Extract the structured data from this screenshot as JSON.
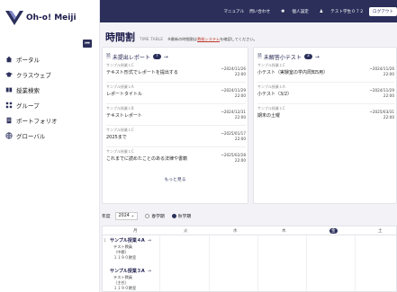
{
  "app": {
    "logo_text": "Oh-o! Meiji"
  },
  "sidebar": {
    "collapse_icon": "⏮",
    "items": [
      {
        "label": "ポータル",
        "icon": "home-icon"
      },
      {
        "label": "クラスウェブ",
        "icon": "graduation-cap-icon"
      },
      {
        "label": "授業検索",
        "icon": "book-icon"
      },
      {
        "label": "グループ",
        "icon": "group-icon"
      },
      {
        "label": "ポートフォリオ",
        "icon": "portfolio-icon"
      },
      {
        "label": "グローバル",
        "icon": "globe-icon"
      }
    ]
  },
  "header": {
    "links": {
      "manual": "マニュアル",
      "contact": "問い合わせ",
      "settings": "個人設定",
      "user": "テスト学生０７２",
      "logout": "ログアウト"
    }
  },
  "page": {
    "title": "時間割",
    "subtitle": "TIME TABLE",
    "note_prefix": "※最新の時間割は",
    "note_link": "教務システム",
    "note_suffix": "を確認してください。"
  },
  "reports": {
    "title": "未提出レポート",
    "count": "7",
    "more_label": "もっと見る",
    "items": [
      {
        "category": "サンプル授業１C",
        "title": "テキスト形式でレポートを提出する",
        "due_date": "~2024/11/26",
        "due_time": "22:00"
      },
      {
        "category": "サンプル授業１A",
        "title": "レポートタイトル",
        "due_date": "~2024/11/29",
        "due_time": "22:00"
      },
      {
        "category": "サンプル授業１B",
        "title": "テキストレポート",
        "due_date": "~2024/12/31",
        "due_time": "22:00"
      },
      {
        "category": "サンプル授業１C",
        "title": "2025まで",
        "due_date": "~2025/01/17",
        "due_time": "22:00"
      },
      {
        "category": "サンプル授業１C",
        "title": "これまでに読めたことのある法律や書籍",
        "due_date": "~2025/02/28",
        "due_time": "22:00"
      }
    ]
  },
  "quizzes": {
    "title": "未解答小テスト",
    "count": "3",
    "items": [
      {
        "category": "サンプル授業１C",
        "title": "小テスト（実験室の学内周知5用）",
        "due_date": "~2024/11/26",
        "due_time": "22:00"
      },
      {
        "category": "サンプル授業１A",
        "title": "小テスト（3/2）",
        "due_date": "~2024/11/29",
        "due_time": "22:00"
      },
      {
        "category": "サンプル授業１C",
        "title": "期末の土曜",
        "due_date": "~2025/03/31",
        "due_time": "22:00"
      }
    ]
  },
  "filters": {
    "year_label": "年度",
    "year_value": "2024",
    "term_spring": "春学期",
    "term_fall": "秋学期"
  },
  "timetable": {
    "days": [
      "月",
      "火",
      "水",
      "木",
      "金",
      "土"
    ],
    "period_label": "1",
    "courses": [
      {
        "name": "サンプル授業４A",
        "teacher": "テスト教員（中郡）",
        "room": "１１９０教室"
      },
      {
        "name": "サンプル授業３A",
        "teacher": "テスト教員（主任）",
        "room": "１１９０教室"
      }
    ]
  }
}
